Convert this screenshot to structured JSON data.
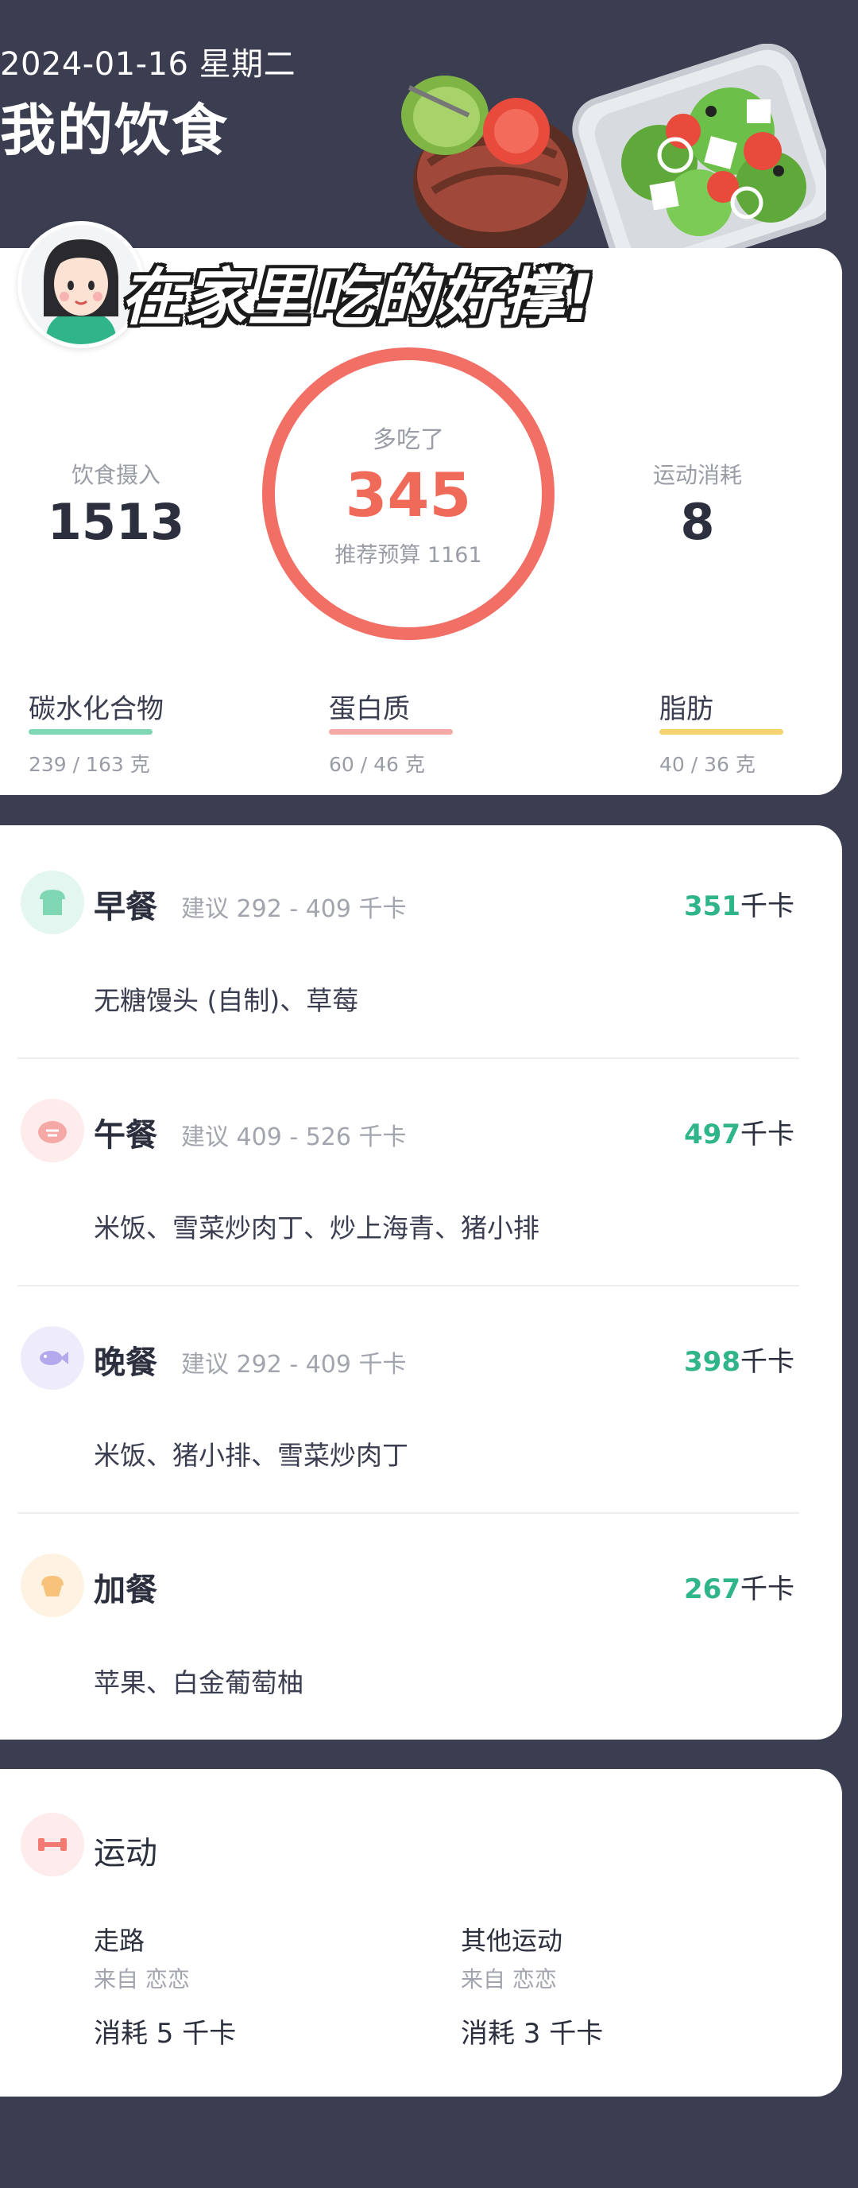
{
  "header": {
    "date": "2024-01-16 星期二",
    "title": "我的饮食"
  },
  "banner": "在家里吃的好撑!",
  "summary": {
    "intake_label": "饮食摄入",
    "intake_value": "1513",
    "over_label": "多吃了",
    "over_value": "345",
    "budget_label": "推荐预算 1161",
    "exercise_label": "运动消耗",
    "exercise_value": "8",
    "macros": [
      {
        "name": "碳水化合物",
        "value": "239 / 163 克",
        "color": "#7fd8b3"
      },
      {
        "name": "蛋白质",
        "value": "60 / 46 克",
        "color": "#f4a9a6"
      },
      {
        "name": "脂肪",
        "value": "40 / 36 克",
        "color": "#f6d36e"
      }
    ]
  },
  "meals": [
    {
      "name": "早餐",
      "suggest": "建议 292 - 409 千卡",
      "kcal": "351",
      "unit": "千卡",
      "foods": "无糖馒头 (自制)、草莓",
      "icon": "bread-icon"
    },
    {
      "name": "午餐",
      "suggest": "建议 409 - 526 千卡",
      "kcal": "497",
      "unit": "千卡",
      "foods": "米饭、雪菜炒肉丁、炒上海青、猪小排",
      "icon": "steak-icon"
    },
    {
      "name": "晚餐",
      "suggest": "建议 292 - 409 千卡",
      "kcal": "398",
      "unit": "千卡",
      "foods": "米饭、猪小排、雪菜炒肉丁",
      "icon": "fish-icon"
    },
    {
      "name": "加餐",
      "suggest": "",
      "kcal": "267",
      "unit": "千卡",
      "foods": "苹果、白金葡萄柚",
      "icon": "cupcake-icon"
    }
  ],
  "exercise": {
    "title": "运动",
    "items": [
      {
        "name": "走路",
        "source": "来自 恋恋",
        "burn": "消耗 5 千卡"
      },
      {
        "name": "其他运动",
        "source": "来自 恋恋",
        "burn": "消耗 3 千卡"
      }
    ]
  }
}
